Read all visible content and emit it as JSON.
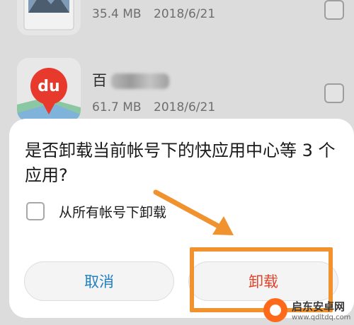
{
  "background_list": {
    "items": [
      {
        "name": "",
        "size": "35.4 MB",
        "date": "2018/6/21",
        "icon": "photo-app-icon"
      },
      {
        "name": "百",
        "size": "61.7 MB",
        "date": "2018/6/21",
        "icon": "baidu-map-icon",
        "icon_text": "du"
      }
    ]
  },
  "dialog": {
    "title": "是否卸载当前帐号下的快应用中心等 3 个应用?",
    "option_label": "从所有帐号下卸载",
    "cancel_label": "取消",
    "uninstall_label": "卸载"
  },
  "watermark": {
    "name": "启东安卓网",
    "url": "www.qdltdq.com"
  },
  "colors": {
    "cancel_text": "#1f7fbf",
    "uninstall_text": "#e2412a",
    "annotation": "#f0922e",
    "map_pin": "#e8392d"
  }
}
